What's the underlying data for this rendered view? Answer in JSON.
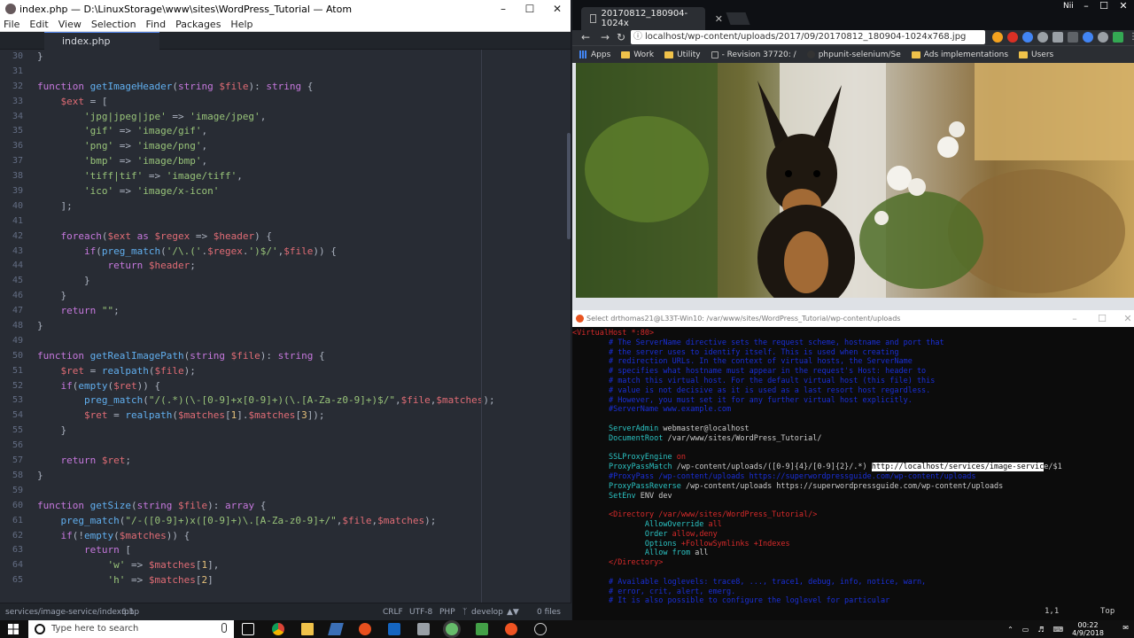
{
  "atom": {
    "title": "index.php — D:\\LinuxStorage\\www\\sites\\WordPress_Tutorial — Atom",
    "menu": [
      "File",
      "Edit",
      "View",
      "Selection",
      "Find",
      "Packages",
      "Help"
    ],
    "tab": "index.php",
    "status": {
      "path": "services/image-service/index.php",
      "cursor": "6:1",
      "line_ending": "CRLF",
      "encoding": "UTF-8",
      "grammar": "PHP",
      "branch": "develop",
      "files": "0 files"
    },
    "code": [
      {
        "n": "30",
        "h": "<span>}</span>"
      },
      {
        "n": "31",
        "h": ""
      },
      {
        "n": "32",
        "h": "<span class=\"kw\">function</span> <span class=\"fn\">getImageHeader</span>(<span class=\"kw\">string</span> <span class=\"var\">$file</span>): <span class=\"kw\">string</span> {"
      },
      {
        "n": "33",
        "h": "    <span class=\"var\">$ext</span> = ["
      },
      {
        "n": "34",
        "h": "        <span class=\"str\">'jpg|jpeg|jpe'</span> => <span class=\"str\">'image/jpeg'</span>,"
      },
      {
        "n": "35",
        "h": "        <span class=\"str\">'gif'</span> => <span class=\"str\">'image/gif'</span>,"
      },
      {
        "n": "36",
        "h": "        <span class=\"str\">'png'</span> => <span class=\"str\">'image/png'</span>,"
      },
      {
        "n": "37",
        "h": "        <span class=\"str\">'bmp'</span> => <span class=\"str\">'image/bmp'</span>,"
      },
      {
        "n": "38",
        "h": "        <span class=\"str\">'tiff|tif'</span> => <span class=\"str\">'image/tiff'</span>,"
      },
      {
        "n": "39",
        "h": "        <span class=\"str\">'ico'</span> => <span class=\"str\">'image/x-icon'</span>"
      },
      {
        "n": "40",
        "h": "    ];"
      },
      {
        "n": "41",
        "h": ""
      },
      {
        "n": "42",
        "h": "    <span class=\"kw\">foreach</span>(<span class=\"var\">$ext</span> <span class=\"kw\">as</span> <span class=\"var\">$regex</span> => <span class=\"var\">$header</span>) {"
      },
      {
        "n": "43",
        "h": "        <span class=\"kw\">if</span>(<span class=\"fn\">preg_match</span>(<span class=\"str\">'/\\.('</span>.<span class=\"var\">$regex</span>.<span class=\"str\">')$/'</span>,<span class=\"var\">$file</span>)) {"
      },
      {
        "n": "44",
        "h": "            <span class=\"kw\">return</span> <span class=\"var\">$header</span>;"
      },
      {
        "n": "45",
        "h": "        }"
      },
      {
        "n": "46",
        "h": "    }"
      },
      {
        "n": "47",
        "h": "    <span class=\"kw\">return</span> <span class=\"str\">\"\"</span>;"
      },
      {
        "n": "48",
        "h": "}"
      },
      {
        "n": "49",
        "h": ""
      },
      {
        "n": "50",
        "h": "<span class=\"kw\">function</span> <span class=\"fn\">getRealImagePath</span>(<span class=\"kw\">string</span> <span class=\"var\">$file</span>): <span class=\"kw\">string</span> {"
      },
      {
        "n": "51",
        "h": "    <span class=\"var\">$ret</span> = <span class=\"fn\">realpath</span>(<span class=\"var\">$file</span>);"
      },
      {
        "n": "52",
        "h": "    <span class=\"kw\">if</span>(<span class=\"fn\">empty</span>(<span class=\"var\">$ret</span>)) {"
      },
      {
        "n": "53",
        "h": "        <span class=\"fn\">preg_match</span>(<span class=\"str\">\"/(.*)(\\-[0-9]+x[0-9]+)(\\.[A-Za-z0-9]+)$/\"</span>,<span class=\"var\">$file</span>,<span class=\"var\">$matches</span>);"
      },
      {
        "n": "54",
        "h": "        <span class=\"var\">$ret</span> = <span class=\"fn\">realpath</span>(<span class=\"var\">$matches</span>[<span class=\"ty\">1</span>].<span class=\"var\">$matches</span>[<span class=\"ty\">3</span>]);"
      },
      {
        "n": "55",
        "h": "    }"
      },
      {
        "n": "56",
        "h": ""
      },
      {
        "n": "57",
        "h": "    <span class=\"kw\">return</span> <span class=\"var\">$ret</span>;"
      },
      {
        "n": "58",
        "h": "}"
      },
      {
        "n": "59",
        "h": ""
      },
      {
        "n": "60",
        "h": "<span class=\"kw\">function</span> <span class=\"fn\">getSize</span>(<span class=\"kw\">string</span> <span class=\"var\">$file</span>): <span class=\"kw\">array</span> {"
      },
      {
        "n": "61",
        "h": "    <span class=\"fn\">preg_match</span>(<span class=\"str\">\"/-([0-9]+)x([0-9]+)\\.[A-Za-z0-9]+/\"</span>,<span class=\"var\">$file</span>,<span class=\"var\">$matches</span>);"
      },
      {
        "n": "62",
        "h": "    <span class=\"kw\">if</span>(!<span class=\"fn\">empty</span>(<span class=\"var\">$matches</span>)) {"
      },
      {
        "n": "63",
        "h": "        <span class=\"kw\">return</span> ["
      },
      {
        "n": "64",
        "h": "            <span class=\"str\">'w'</span> => <span class=\"var\">$matches</span>[<span class=\"ty\">1</span>],"
      },
      {
        "n": "65",
        "h": "            <span class=\"str\">'h'</span> => <span class=\"var\">$matches</span>[<span class=\"ty\">2</span>]"
      }
    ]
  },
  "chrome": {
    "tab_title": "20170812_180904-1024x",
    "user": "Nii",
    "url": "localhost/wp-content/uploads/2017/09/20170812_180904-1024x768.jpg",
    "bookmarks": [
      "Apps",
      "Work",
      "Utility",
      "- Revision 37720: /",
      "phpunit-selenium/Se",
      "Ads implementations",
      "Users"
    ]
  },
  "terminal": {
    "title": "Select drthomas21@L33T-Win10: /var/www/sites/WordPress_Tutorial/wp-content/uploads",
    "lines": [
      {
        "h": "<span class=\"red\">&lt;VirtualHost *:80&gt;</span>"
      },
      {
        "h": "        <span class=\"blue\"># The ServerName directive sets the request scheme, hostname and port that</span>"
      },
      {
        "h": "        <span class=\"blue\"># the server uses to identify itself. This is used when creating</span>"
      },
      {
        "h": "        <span class=\"blue\"># redirection URLs. In the context of virtual hosts, the ServerName</span>"
      },
      {
        "h": "        <span class=\"blue\"># specifies what hostname must appear in the request's Host: header to</span>"
      },
      {
        "h": "        <span class=\"blue\"># match this virtual host. For the default virtual host (this file) this</span>"
      },
      {
        "h": "        <span class=\"blue\"># value is not decisive as it is used as a last resort host regardless.</span>"
      },
      {
        "h": "        <span class=\"blue\"># However, you must set it for any further virtual host explicitly.</span>"
      },
      {
        "h": "        <span class=\"blue\">#ServerName www.example.com</span>"
      },
      {
        "h": ""
      },
      {
        "h": "        <span class=\"cyan\">ServerAdmin</span> webmaster@localhost"
      },
      {
        "h": "        <span class=\"cyan\">DocumentRoot</span> /var/www/sites/WordPress_Tutorial/"
      },
      {
        "h": ""
      },
      {
        "h": "        <span class=\"cyan\">SSLProxyEngine</span> <span class=\"red\">on</span>"
      },
      {
        "h": "        <span class=\"cyan\">ProxyPassMatch</span> /wp-content/uploads/([0-9]{4}/[0-9]{2}/.*) <span class=\"hl\">http://localhost/services/image-servic</span>e/$1"
      },
      {
        "h": "        <span class=\"blue\">#ProxyPass /wp-content/uploads https://superwordpressguide.com/wp-content/uploads</span>"
      },
      {
        "h": "        <span class=\"cyan\">ProxyPassReverse</span> /wp-content/uploads https://superwordpressguide.com/wp-content/uploads"
      },
      {
        "h": "        <span class=\"cyan\">SetEnv</span> ENV dev"
      },
      {
        "h": ""
      },
      {
        "h": "        <span class=\"red\">&lt;Directory /var/www/sites/WordPress_Tutorial/&gt;</span>"
      },
      {
        "h": "                <span class=\"cyan\">AllowOverride</span> <span class=\"red\">all</span>"
      },
      {
        "h": "                <span class=\"cyan\">Order</span> <span class=\"red\">allow,deny</span>"
      },
      {
        "h": "                <span class=\"cyan\">Options</span> <span class=\"red\">+FollowSymlinks +Indexes</span>"
      },
      {
        "h": "                <span class=\"cyan\">Allow from</span> all"
      },
      {
        "h": "        <span class=\"red\">&lt;/Directory&gt;</span>"
      },
      {
        "h": ""
      },
      {
        "h": "        <span class=\"blue\"># Available loglevels: trace8, ..., trace1, debug, info, notice, warn,</span>"
      },
      {
        "h": "        <span class=\"blue\"># error, crit, alert, emerg.</span>"
      },
      {
        "h": "        <span class=\"blue\"># It is also possible to configure the loglevel for particular</span>"
      }
    ],
    "position": "1,1",
    "scroll": "Top"
  },
  "taskbar": {
    "search_placeholder": "Type here to search",
    "time": "00:22",
    "date": "4/9/2018"
  }
}
